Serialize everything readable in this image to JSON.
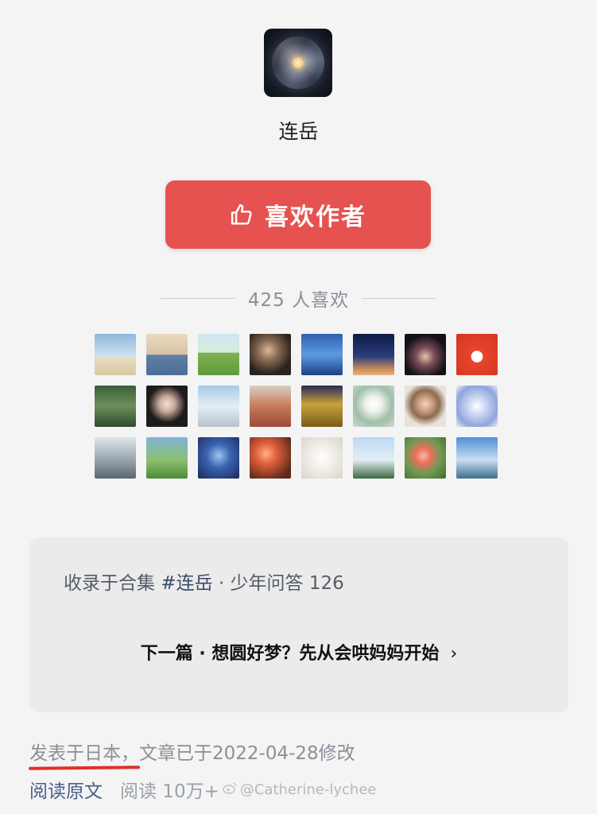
{
  "author": {
    "name": "连岳",
    "avatar_icon": "galaxy-avatar"
  },
  "like_button": {
    "label": "喜欢作者",
    "icon": "thumbs-up-icon",
    "color": "#e5524f"
  },
  "likes": {
    "count_text": "425 人喜欢",
    "likers": [
      {
        "icon": "beach-person-avatar",
        "bg": "linear-gradient(180deg,#8fb8dd 0%,#cfe2f0 55%,#e9dcc0 56%,#d8c7a2 100%)"
      },
      {
        "icon": "child-avatar",
        "bg": "linear-gradient(180deg,#e9d9c2 0%,#d9c2a3 50%,#5f7fa6 51%,#4d6d95 100%)"
      },
      {
        "icon": "green-field-avatar",
        "bg": "linear-gradient(180deg,#cfe6f2 0%,#d7ecd8 45%,#7fb256 46%,#5f9a3a 100%)"
      },
      {
        "icon": "portrait-dark-avatar",
        "bg": "radial-gradient(circle at 45% 40%,#d9b89a 0%,#8a6a52 30%,#2a2420 70%)"
      },
      {
        "icon": "sea-creature-avatar",
        "bg": "linear-gradient(180deg,#2f5fb0 0%,#5e9ae0 50%,#1b3f85 100%)"
      },
      {
        "icon": "dusk-sky-avatar",
        "bg": "linear-gradient(180deg,#0d1a44 0%,#2b3f7d 55%,#c98a5a 85%,#e7b27a 100%)"
      },
      {
        "icon": "night-portrait-avatar",
        "bg": "radial-gradient(circle at 50% 55%,#e7c1a8 0%,#7a4d57 30%,#141018 70%)"
      },
      {
        "icon": "red-fox-cartoon-avatar",
        "bg": "radial-gradient(circle at 50% 55%,#fff 0%,#fff 18%,#e8442e 20%,#d4361f 100%)"
      },
      {
        "icon": "garden-arch-avatar",
        "bg": "linear-gradient(180deg,#3c5f3a 0%,#6c8f5a 50%,#2f4a2c 100%)"
      },
      {
        "icon": "bunny-hoodie-avatar",
        "bg": "radial-gradient(circle at 50% 45%,#f1e2d6 0%,#c9a99b 25%,#1c1c1c 60%)"
      },
      {
        "icon": "snow-landscape-avatar",
        "bg": "linear-gradient(180deg,#a9c9e6 0%,#e2eef7 50%,#b7c3cc 100%)"
      },
      {
        "icon": "crowd-festival-avatar",
        "bg": "linear-gradient(180deg,#d7cfc4 0%,#c77a5b 50%,#9a4a3a 100%)"
      },
      {
        "icon": "night-lights-avatar",
        "bg": "linear-gradient(180deg,#2a2a5a 0%,#c8a23a 45%,#7a5a1a 100%)"
      },
      {
        "icon": "white-flowers-avatar",
        "bg": "radial-gradient(circle at 50% 45%,#ffffff 0%,#eef2ee 25%,#9fbfa8 60%,#cfd8d2 100%)"
      },
      {
        "icon": "woman-portrait-avatar",
        "bg": "radial-gradient(circle at 50% 45%,#f2d3bd 0%,#c89b7c 25%,#8a6a4f 45%,#e9e2d8 70%)"
      },
      {
        "icon": "cartoon-character-avatar",
        "bg": "radial-gradient(circle at 50% 50%,#ffffff 0%,#cdd7f2 30%,#8ea4dc 70%,#eef0f8 100%)"
      },
      {
        "icon": "cloudy-sky-avatar",
        "bg": "linear-gradient(180deg,#dfe5ea 0%,#9eaab4 50%,#5c6670 100%)"
      },
      {
        "icon": "totoro-avatar",
        "bg": "linear-gradient(180deg,#7fb3d9 0%,#8cc06e 55%,#4f8a3a 100%)"
      },
      {
        "icon": "blue-mask-avatar",
        "bg": "radial-gradient(circle at 50% 45%,#9cc4f0 0%,#3a62b0 40%,#1a2a5a 100%)"
      },
      {
        "icon": "orange-flowers-avatar",
        "bg": "radial-gradient(circle at 40% 40%,#ffb08a 0%,#e0603a 30%,#5a2a1a 80%)"
      },
      {
        "icon": "white-dog-avatar",
        "bg": "radial-gradient(circle at 50% 50%,#ffffff 0%,#f2efe9 40%,#d9d4cc 100%)"
      },
      {
        "icon": "seaside-girl-avatar",
        "bg": "linear-gradient(180deg,#bcd9f2 0%,#e3eef7 55%,#3a6a3f 100%)"
      },
      {
        "icon": "roses-avatar",
        "bg": "radial-gradient(circle at 45% 45%,#ffb3a3 0%,#e86f5a 25%,#6f9a52 55%,#3f6a2f 100%)"
      },
      {
        "icon": "coastal-view-avatar",
        "bg": "linear-gradient(180deg,#4f8fd6 0%,#c9def2 55%,#3d6f8f 100%)"
      }
    ]
  },
  "collection": {
    "prefix": "收录于合集 ",
    "tag": "#连岳",
    "suffix": " · 少年问答 126",
    "next_article": "下一篇 · 想圆好梦？先从会哄妈妈开始",
    "chevron": "›"
  },
  "footer": {
    "publish_info": "发表于日本，文章已于2022-04-28修改",
    "read_original": "阅读原文",
    "read_count": "阅读 10万+",
    "watermark": "@Catherine-lychee"
  }
}
